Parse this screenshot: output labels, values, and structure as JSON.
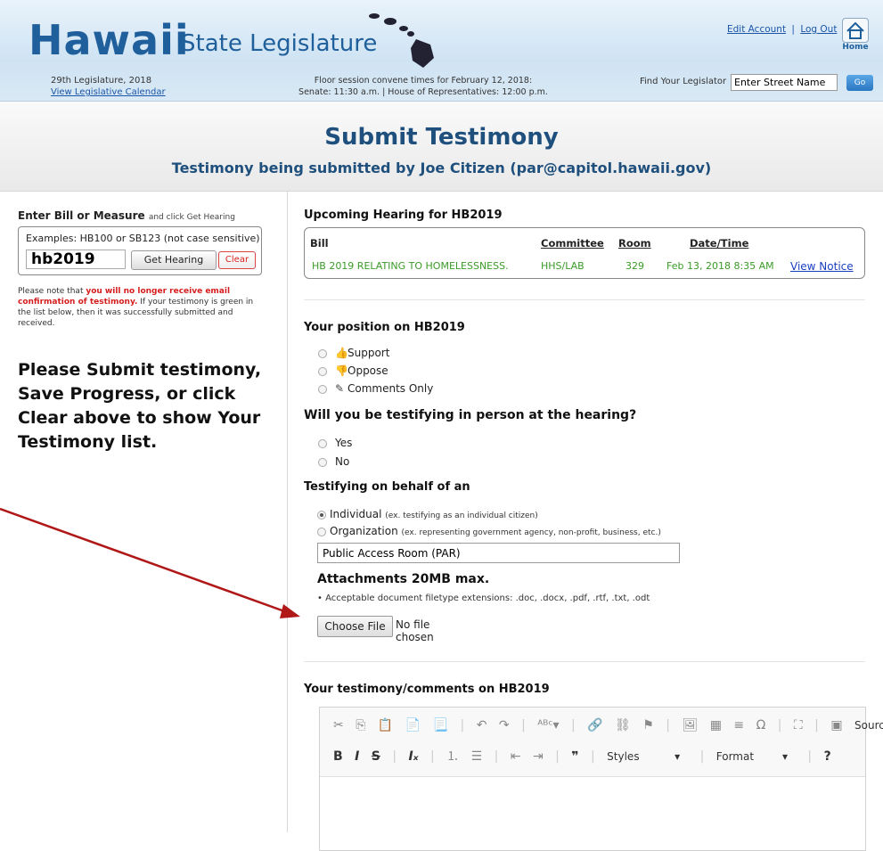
{
  "header": {
    "logo_hawaii": "Hawaii",
    "logo_rest": "State Legislature",
    "legislature": "29th Legislature, 2018",
    "calendar_link": "View Legislative Calendar",
    "floor_session_line1": "Floor session convene times for February 12, 2018:",
    "floor_session_line2": "Senate: 11:30 a.m. | House of Representatives: 12:00 p.m.",
    "edit_account": "Edit Account",
    "separator": "|",
    "log_out": "Log Out",
    "home": "Home",
    "find_label": "Find Your Legislator",
    "find_value": "Enter Street Name",
    "go": "Go"
  },
  "title": {
    "main": "Submit Testimony",
    "sub": "Testimony being submitted by Joe Citizen (par@capitol.hawaii.gov)"
  },
  "left": {
    "enter_label": "Enter Bill or Measure",
    "enter_hint": "and click Get Hearing",
    "examples": "Examples: HB100 or SB123 (not case sensitive)",
    "bill_value": "hb2019",
    "get_hearing": "Get Hearing",
    "clear": "Clear",
    "note_a": "Please note that ",
    "note_red": "you will no longer receive email confirmation of testimony.",
    "note_b": " If your testimony is green in the list below, then it was successfully submitted and received.",
    "please": "Please Submit testimony, Save Progress, or click Clear above to show Your Testimony list."
  },
  "hearing": {
    "heading": "Upcoming Hearing for HB2019",
    "col_bill": "Bill",
    "col_committee": "Committee",
    "col_room": "Room",
    "col_datetime": "Date/Time",
    "bill": "HB 2019 RELATING TO HOMELESSNESS.",
    "committee": "HHS/LAB",
    "room": "329",
    "datetime": "Feb 13, 2018 8:35 AM",
    "view_notice": "View Notice"
  },
  "position": {
    "heading": "Your position on HB2019",
    "support": "Support",
    "oppose": "Oppose",
    "comments": "Comments Only"
  },
  "in_person": {
    "heading": "Will you be testifying in person at the hearing?",
    "yes": "Yes",
    "no": "No"
  },
  "behalf": {
    "heading": "Testifying on behalf of an",
    "individual": "Individual",
    "individual_ex": "(ex. testifying as an individual citizen)",
    "organization": "Organization",
    "organization_ex": "(ex. representing government agency, non-profit, business, etc.)",
    "org_value": "Public Access Room (PAR)"
  },
  "attachments": {
    "heading": "Attachments 20MB max.",
    "note": "• Acceptable document filetype extensions: .doc, .docx, .pdf, .rtf, .txt, .odt",
    "choose": "Choose File",
    "no_file": "No file chosen"
  },
  "testimony": {
    "heading": "Your testimony/comments on HB2019",
    "source": "Source",
    "styles": "Styles",
    "format": "Format"
  },
  "colors": {
    "brand_blue": "#1f5f9b",
    "green": "#3a9b27",
    "red": "#d61d1d",
    "arrow": "#b01818"
  }
}
